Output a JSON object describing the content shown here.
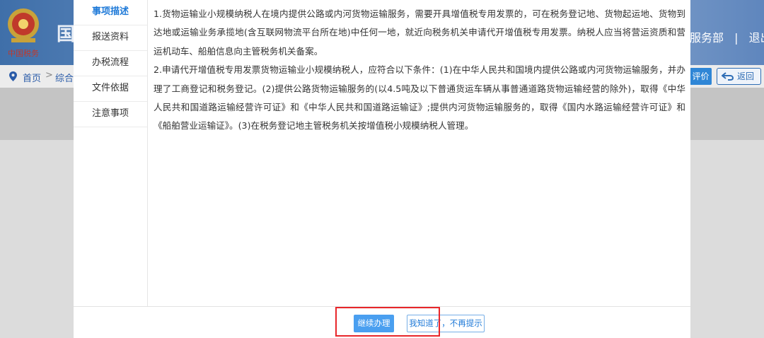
{
  "header": {
    "site_char": "国",
    "emblem_text": "中国税务",
    "topnav": {
      "service": "服务部",
      "separator": "|",
      "exit": "退出"
    }
  },
  "breadcrumb": {
    "home": "首页",
    "separator": ">",
    "category": "综合",
    "evaluate_label": "评价",
    "back_label": "返回"
  },
  "modal": {
    "tabs": [
      {
        "label": "事项描述",
        "active": true
      },
      {
        "label": "报送资料",
        "active": false
      },
      {
        "label": "办税流程",
        "active": false
      },
      {
        "label": "文件依据",
        "active": false
      },
      {
        "label": "注意事项",
        "active": false
      }
    ],
    "paragraphs": [
      "1.货物运输业小规模纳税人在境内提供公路或内河货物运输服务，需要开具增值税专用发票的，可在税务登记地、货物起运地、货物到达地或运输业务承揽地(含互联网物流平台所在地)中任何一地，就近向税务机关申请代开增值税专用发票。纳税人应当将营运资质和营运机动车、船舶信息向主管税务机关备案。",
      "2.申请代开增值税专用发票货物运输业小规模纳税人，应符合以下条件：(1)在中华人民共和国境内提供公路或内河货物运输服务，并办理了工商登记和税务登记。(2)提供公路货物运输服务的(以4.5吨及以下普通货运车辆从事普通道路货物运输经营的除外)，取得《中华人民共和国道路运输经营许可证》和《中华人民共和国道路运输证》;提供内河货物运输服务的，取得《国内水路运输经营许可证》和《船舶营业运输证》。(3)在税务登记地主管税务机关按增值税小规模纳税人管理。"
    ],
    "buttons": {
      "continue": "继续办理",
      "dismiss": "我知道了，不再提示"
    }
  },
  "colors": {
    "accent": "#1f7ad8",
    "primary_button": "#4a9ff0",
    "highlight_box": "#e8262a"
  }
}
